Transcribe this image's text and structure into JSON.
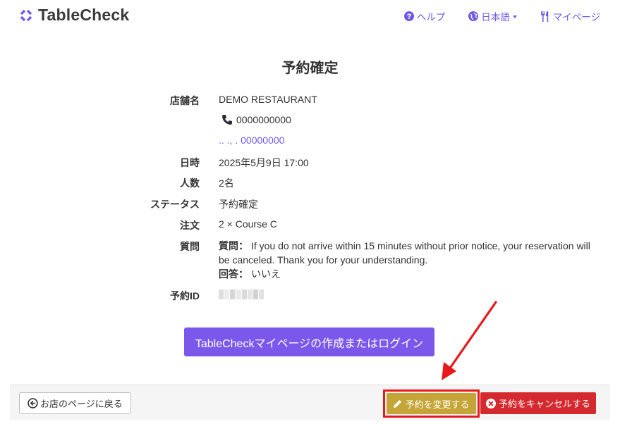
{
  "header": {
    "logo_text": "TableCheck",
    "nav": {
      "help_label": "ヘルプ",
      "language_label": "日本語",
      "mypage_label": "マイページ"
    }
  },
  "title": "予約確定",
  "details": {
    "store_label": "店舗名",
    "store_name": "DEMO RESTAURANT",
    "phone": "0000000000",
    "address_link": ".. ., . 00000000",
    "date_label": "日時",
    "date_value": "2025年5月9日 17:00",
    "people_label": "人数",
    "people_value": "2名",
    "status_label": "ステータス",
    "status_value": "予約確定",
    "order_label": "注文",
    "order_value": "2 × Course C",
    "question_label": "質問",
    "question_prefix": "質問：",
    "question_text": "If you do not arrive within 15 minutes without prior notice, your reservation will be canceled. Thank you for your understanding.",
    "answer_prefix": "回答：",
    "answer_text": "いいえ",
    "reservation_id_label": "予約ID"
  },
  "mypage_button_label": "TableCheckマイページの作成またはログイン",
  "footer": {
    "back_label": "お店のページに戻る",
    "change_label": "予約を変更する",
    "cancel_label": "予約をキャンセルする"
  },
  "colors": {
    "brand_purple": "#7b57ec",
    "link_purple": "#7358e8",
    "change_gold": "#c5a537",
    "cancel_red": "#d42a2f",
    "annotation_red": "#e8191b"
  }
}
